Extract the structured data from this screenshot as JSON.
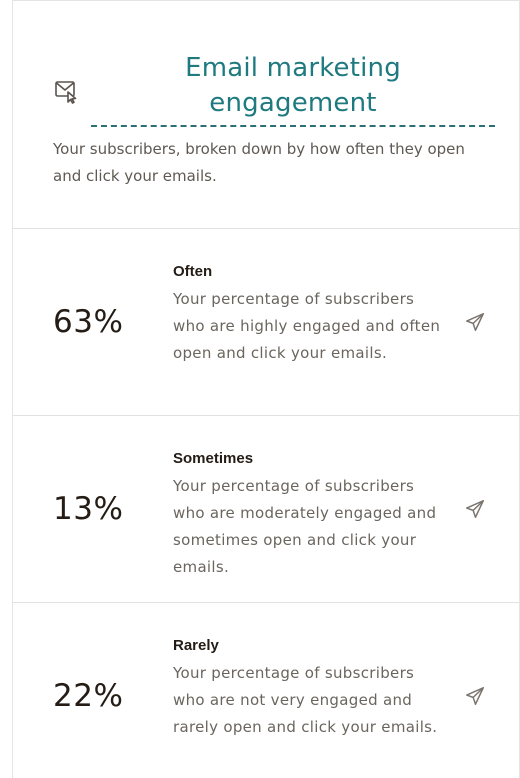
{
  "header": {
    "title": "Email marketing engagement",
    "subtitle": "Your subscribers, broken down by how often they open and click your emails.",
    "icon": "email-click-icon"
  },
  "rows": [
    {
      "percent": "63%",
      "label": "Often",
      "description": "Your percentage of subscribers who are highly engaged and often open and click your emails.",
      "icon": "send-icon"
    },
    {
      "percent": "13%",
      "label": "Sometimes",
      "description": "Your percentage of subscribers who are moderately engaged and sometimes open and click your emails.",
      "icon": "send-icon"
    },
    {
      "percent": "22%",
      "label": "Rarely",
      "description": "Your percentage of subscribers who are not very engaged and rarely open and click your emails.",
      "icon": "send-icon"
    }
  ],
  "colors": {
    "title": "#1f7a80",
    "text": "#241c15",
    "muted": "#6b655e",
    "divider": "#e3e1de"
  }
}
